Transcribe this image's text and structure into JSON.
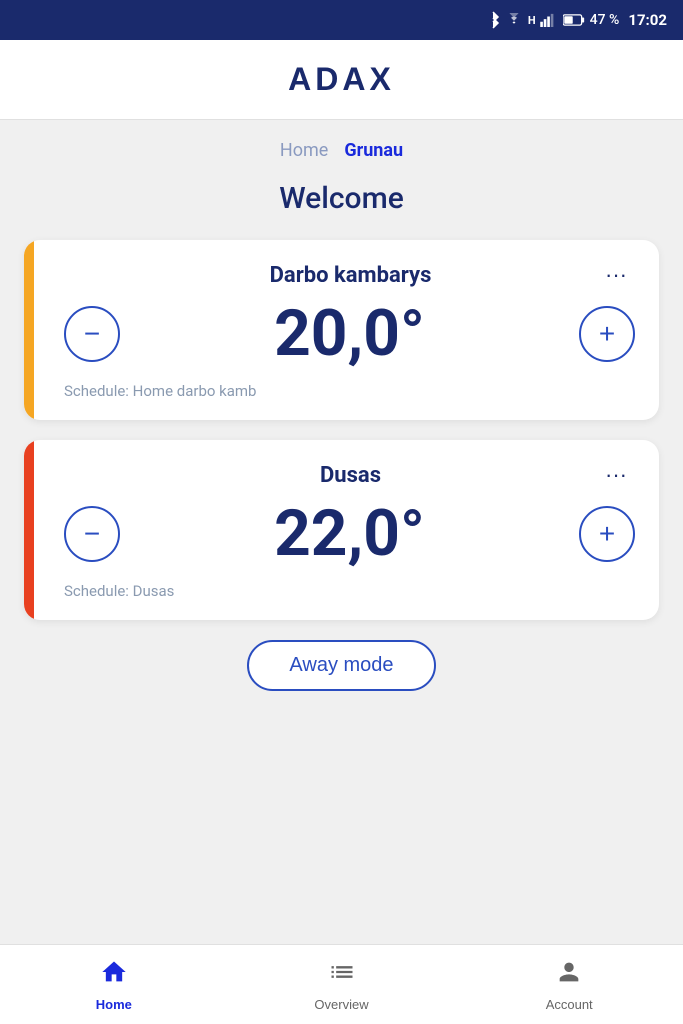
{
  "status_bar": {
    "battery": "47 %",
    "time": "17:02"
  },
  "header": {
    "logo": "ADAX"
  },
  "breadcrumb": {
    "items": [
      {
        "label": "Home",
        "active": false
      },
      {
        "label": "Grunau",
        "active": true
      }
    ]
  },
  "welcome": {
    "title": "Welcome"
  },
  "devices": [
    {
      "name": "Darbo kambarys",
      "temperature": "20,0°",
      "schedule": "Schedule: Home darbo kamb",
      "accent": "yellow"
    },
    {
      "name": "Dusas",
      "temperature": "22,0°",
      "schedule": "Schedule: Dusas",
      "accent": "orange"
    }
  ],
  "away_mode": {
    "label": "Away mode"
  },
  "bottom_nav": {
    "items": [
      {
        "id": "home",
        "label": "Home",
        "active": true
      },
      {
        "id": "overview",
        "label": "Overview",
        "active": false
      },
      {
        "id": "account",
        "label": "Account",
        "active": false
      }
    ]
  },
  "controls": {
    "minus_label": "−",
    "plus_label": "+"
  }
}
